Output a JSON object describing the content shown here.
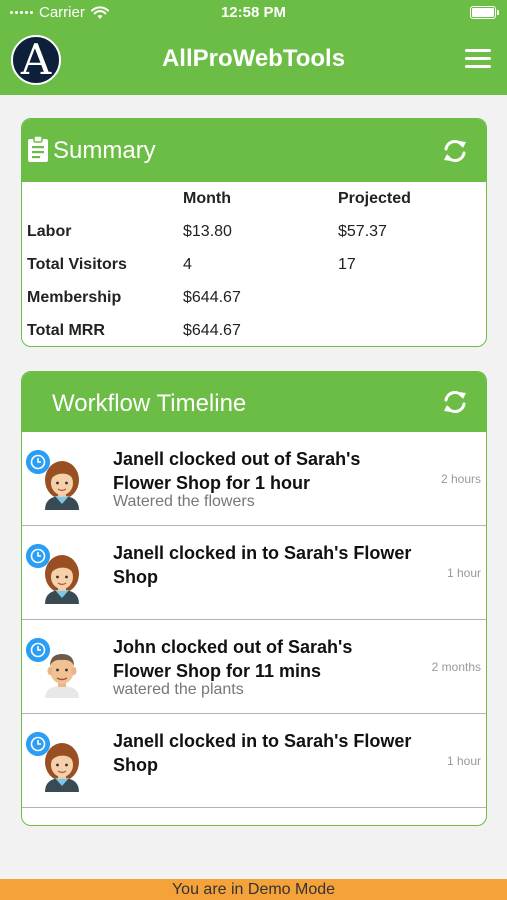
{
  "status": {
    "carrier": "Carrier",
    "time": "12:58 PM"
  },
  "app": {
    "title": "AllProWebTools",
    "logo_letter": "A",
    "accent_color": "#6cbd45"
  },
  "summary": {
    "title": "Summary",
    "columns": [
      "Month",
      "Projected"
    ],
    "rows": [
      {
        "label": "Labor",
        "month": "$13.80",
        "projected": "$57.37"
      },
      {
        "label": "Total Visitors",
        "month": "4",
        "projected": "17"
      },
      {
        "label": "Membership",
        "month": "$644.67",
        "projected": ""
      },
      {
        "label": "Total MRR",
        "month": "$644.67",
        "projected": ""
      }
    ]
  },
  "workflow": {
    "title": "Workflow Timeline",
    "items": [
      {
        "text": "Janell clocked out of Sarah's Flower Shop for 1 hour",
        "note": "Watered the flowers",
        "time": "2 hours",
        "avatar": "female"
      },
      {
        "text": "Janell clocked in to Sarah's Flower Shop",
        "note": "",
        "time": "1 hour",
        "avatar": "female"
      },
      {
        "text": "John clocked out of Sarah's Flower Shop for 11 mins",
        "note": "watered the plants",
        "time": "2 months",
        "avatar": "male"
      },
      {
        "text": "Janell clocked in to Sarah's Flower Shop",
        "note": "",
        "time": "1 hour",
        "avatar": "female"
      }
    ]
  },
  "footer": {
    "demo_text": "You are in Demo Mode",
    "demo_color": "#f6a23a"
  },
  "icons": [
    "wifi-icon",
    "battery-icon",
    "menu-icon",
    "clipboard-icon",
    "refresh-icon",
    "clock-icon",
    "avatar"
  ]
}
